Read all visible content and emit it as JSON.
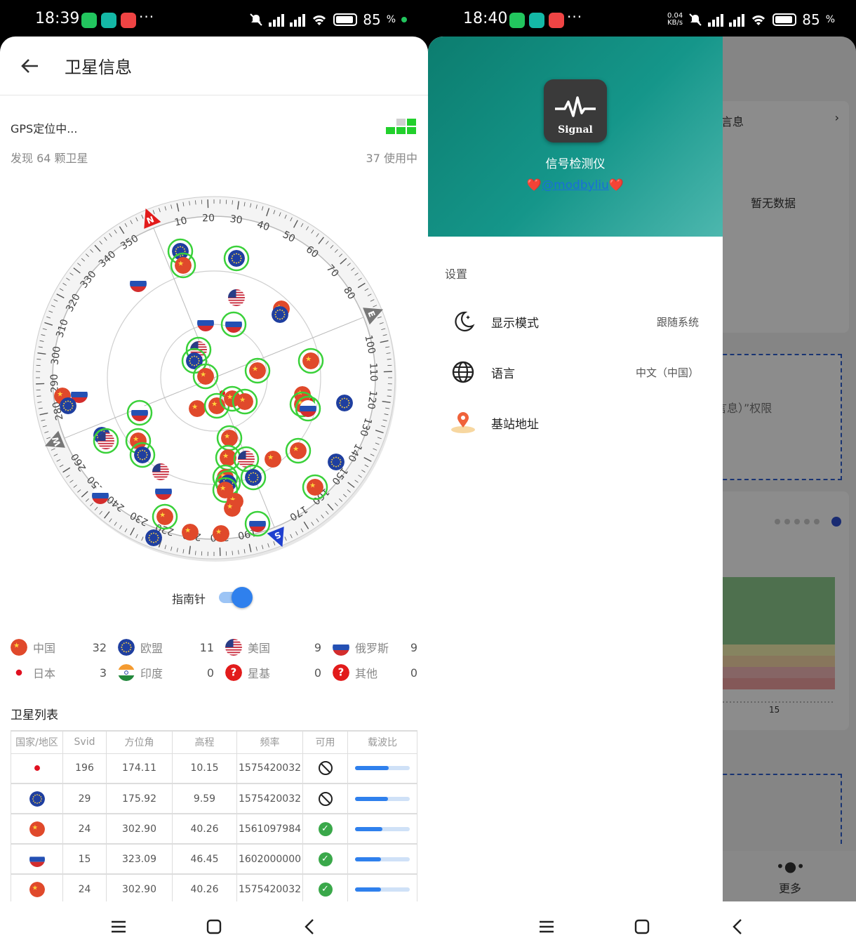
{
  "left": {
    "status": {
      "time": "18:39",
      "battery": "85"
    },
    "title": "卫星信息",
    "gps_status": "GPS定位中...",
    "found": "发现 64 颗卫星",
    "in_use": "37 使用中",
    "compass": {
      "ticks": [
        "10",
        "20",
        "30",
        "40",
        "50",
        "60",
        "70",
        "80",
        "100",
        "110",
        "120",
        "130",
        "140",
        "150",
        "160",
        "170",
        "190",
        "200",
        "210",
        "220",
        "230",
        "240",
        "250",
        "260",
        "280",
        "290",
        "300",
        "310",
        "320",
        "330",
        "340",
        "350"
      ],
      "markers": {
        "n": "N",
        "e": "E",
        "s": "S",
        "w": "W"
      }
    },
    "toggle_label": "指南针",
    "toggle_on": true,
    "legend": [
      {
        "name": "中国",
        "count": "32",
        "flag": "cn"
      },
      {
        "name": "欧盟",
        "count": "11",
        "flag": "eu"
      },
      {
        "name": "美国",
        "count": "9",
        "flag": "us"
      },
      {
        "name": "俄罗斯",
        "count": "9",
        "flag": "ru"
      },
      {
        "name": "日本",
        "count": "3",
        "flag": "jp"
      },
      {
        "name": "印度",
        "count": "0",
        "flag": "in"
      },
      {
        "name": "星基",
        "count": "0",
        "flag": "q"
      },
      {
        "name": "其他",
        "count": "0",
        "flag": "q"
      }
    ],
    "list_title": "卫星列表",
    "table": {
      "headers": [
        "国家/地区",
        "Svid",
        "方位角",
        "高程",
        "频率",
        "可用",
        "载波比"
      ],
      "rows": [
        {
          "flag": "jp",
          "svid": "196",
          "azimuth": "174.11",
          "elevation": "10.15",
          "freq": "1575420032",
          "usable": false,
          "cn": 0.62
        },
        {
          "flag": "eu",
          "svid": "29",
          "azimuth": "175.92",
          "elevation": "9.59",
          "freq": "1575420032",
          "usable": false,
          "cn": 0.6
        },
        {
          "flag": "cn",
          "svid": "24",
          "azimuth": "302.90",
          "elevation": "40.26",
          "freq": "1561097984",
          "usable": true,
          "cn": 0.5
        },
        {
          "flag": "ru",
          "svid": "15",
          "azimuth": "323.09",
          "elevation": "46.45",
          "freq": "1602000000",
          "usable": true,
          "cn": 0.48
        },
        {
          "flag": "cn",
          "svid": "24",
          "azimuth": "302.90",
          "elevation": "40.26",
          "freq": "1575420032",
          "usable": true,
          "cn": 0.48
        }
      ]
    }
  },
  "right": {
    "status": {
      "time": "18:40",
      "netspeed_value": "0.04",
      "netspeed_unit": "KB/s",
      "battery": "85"
    },
    "drawer": {
      "logo_text": "Signal",
      "app_name": "信号检测仪",
      "heart": "❤️",
      "author": "@modbyliu",
      "section": "设置",
      "items": [
        {
          "label": "显示模式",
          "value": "跟随系统",
          "icon": "moon-icon"
        },
        {
          "label": "语言",
          "value": "中文（中国）",
          "icon": "globe-icon"
        },
        {
          "label": "基站地址",
          "value": "",
          "icon": "tower-location-icon"
        }
      ]
    },
    "background": {
      "text_info": "言息",
      "arrow": "›",
      "no_data": "暂无数据",
      "permission": "言息）”权限",
      "axis_tick": "15",
      "more": "更多"
    }
  },
  "colors": {
    "accent": "#2f80ed",
    "teal": "#0c7d6f",
    "china": "#e0492b",
    "eu": "#1f3fa0",
    "ok": "#3aa84a"
  }
}
